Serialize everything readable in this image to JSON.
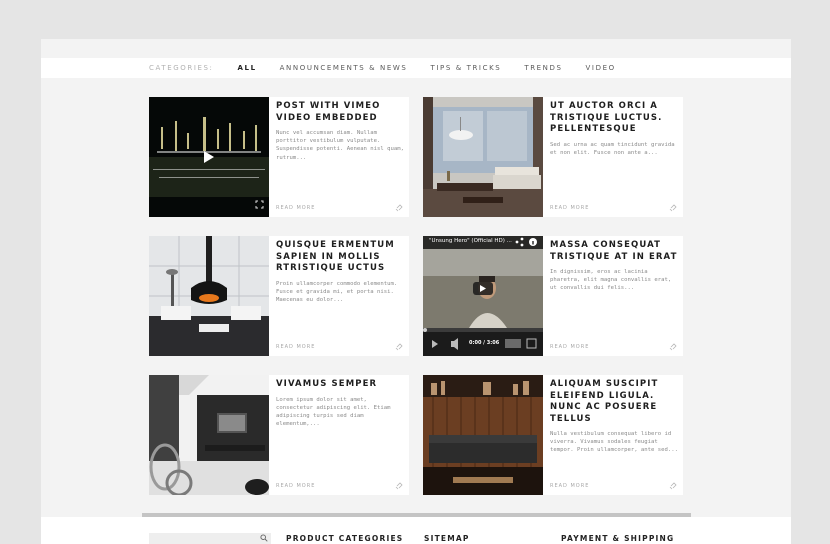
{
  "categories": {
    "label": "CATEGORIES:",
    "items": [
      "ALL",
      "ANNOUNCEMENTS & NEWS",
      "TIPS & TRICKS",
      "TRENDS",
      "VIDEO"
    ]
  },
  "posts": [
    {
      "title": "POST WITH VIMEO VIDEO EMBEDDED",
      "excerpt": "Nunc vel accumsan diam. Nullam porttitor vestibulum vulputate. Suspendisse potenti. Aenean nisl quam, rutrum...",
      "read_more": "READ MORE",
      "thumb": "video-lights"
    },
    {
      "title": "UT AUCTOR ORCI A TRISTIQUE LUCTUS. PELLENTESQUE",
      "excerpt": "Sed ac urna ac quam tincidunt gravida et non elit. Fusce non ante a...",
      "read_more": "READ MORE",
      "thumb": "living-room"
    },
    {
      "title": "QUISQUE ERMENTUM SAPIEN IN MOLLIS RTRISTIQUE UCTUS",
      "excerpt": "Proin ullamcorper commodo elementum. Fusce et gravida mi, et porta nisi. Maecenas eu dolor...",
      "read_more": "READ MORE",
      "thumb": "fireplace-room"
    },
    {
      "title": "MASSA CONSEQUAT TRISTIQUE AT IN ERAT",
      "excerpt": "In dignissim, eros ac lacinia pharetra, elit magna convallis erat, ut convallis dui felis...",
      "read_more": "READ MORE",
      "thumb": "youtube-video",
      "video": {
        "title": "\"Unsung Hero\" (Official HD) ...",
        "time": "0:00 / 3:06"
      }
    },
    {
      "title": "VIVAMUS SEMPER",
      "excerpt": "Lorem ipsum dolor sit amet, consectetur adipiscing elit. Etiam adipiscing turpis sed diam elementum,...",
      "read_more": "READ MORE",
      "thumb": "bw-interior"
    },
    {
      "title": "ALIQUAM SUSCIPIT ELEIFEND LIGULA. NUNC AC POSUERE TELLUS",
      "excerpt": "Nulla vestibulum consequat libero id viverra. Vivamus sodales feugiat tempor. Proin ullamcorper, ante sed...",
      "read_more": "READ MORE",
      "thumb": "wood-wall"
    }
  ],
  "footer": {
    "headings": [
      "PRODUCT CATEGORIES",
      "SITEMAP",
      "PAYMENT & SHIPPING"
    ]
  }
}
